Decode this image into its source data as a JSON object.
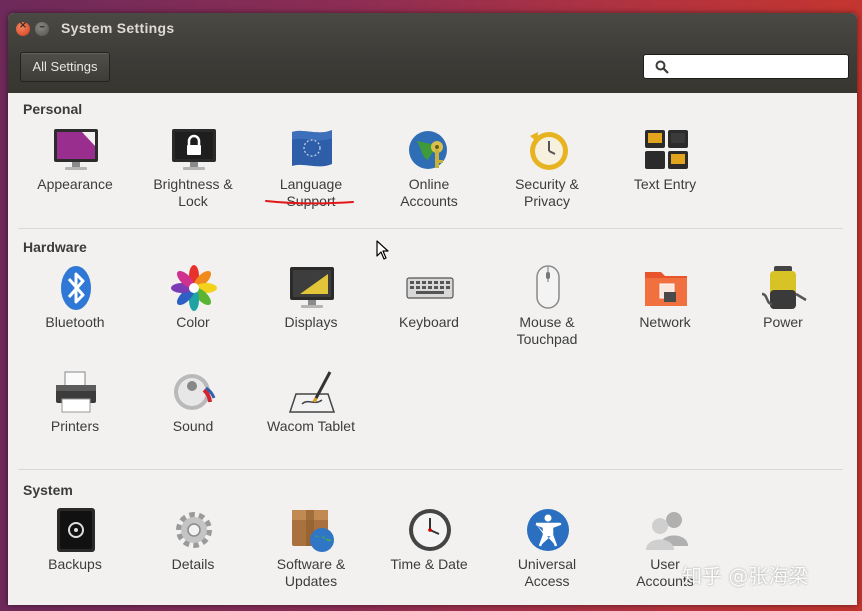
{
  "window": {
    "title": "System Settings"
  },
  "toolbar": {
    "all_settings_label": "All Settings",
    "search_value": ""
  },
  "sections": {
    "personal": {
      "title": "Personal",
      "items": [
        {
          "label": "Appearance",
          "icon": "appearance-icon"
        },
        {
          "label": "Brightness &\nLock",
          "icon": "lock-icon"
        },
        {
          "label": "Language\nSupport",
          "icon": "language-flag-icon"
        },
        {
          "label": "Online\nAccounts",
          "icon": "online-accounts-icon"
        },
        {
          "label": "Security &\nPrivacy",
          "icon": "security-clock-icon"
        },
        {
          "label": "Text Entry",
          "icon": "text-entry-icon"
        }
      ]
    },
    "hardware": {
      "title": "Hardware",
      "items": [
        {
          "label": "Bluetooth",
          "icon": "bluetooth-icon"
        },
        {
          "label": "Color",
          "icon": "color-icon"
        },
        {
          "label": "Displays",
          "icon": "displays-icon"
        },
        {
          "label": "Keyboard",
          "icon": "keyboard-icon"
        },
        {
          "label": "Mouse &\nTouchpad",
          "icon": "mouse-icon"
        },
        {
          "label": "Network",
          "icon": "network-icon"
        },
        {
          "label": "Power",
          "icon": "power-battery-icon"
        },
        {
          "label": "Printers",
          "icon": "printer-icon"
        },
        {
          "label": "Sound",
          "icon": "sound-icon"
        },
        {
          "label": "Wacom Tablet",
          "icon": "wacom-tablet-icon"
        }
      ]
    },
    "system": {
      "title": "System",
      "items": [
        {
          "label": "Backups",
          "icon": "backups-safe-icon"
        },
        {
          "label": "Details",
          "icon": "gear-icon"
        },
        {
          "label": "Software &\nUpdates",
          "icon": "software-package-icon"
        },
        {
          "label": "Time & Date",
          "icon": "clock-icon"
        },
        {
          "label": "Universal\nAccess",
          "icon": "accessibility-icon"
        },
        {
          "label": "User\nAccounts",
          "icon": "users-icon"
        }
      ]
    }
  },
  "watermark": "知乎 @张海梁"
}
